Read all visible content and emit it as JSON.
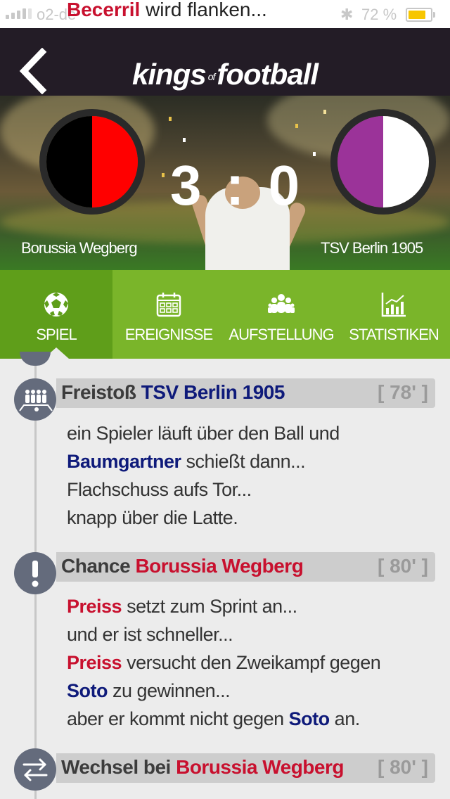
{
  "status_bar": {
    "carrier": "o2-de",
    "banner_player": "Becerril",
    "banner_text": "wird flanken...",
    "battery": "72 %",
    "battery_color": "#f7c600"
  },
  "nav": {
    "back_icon": "chevron-left-icon",
    "logo_kings": "kings",
    "logo_of": "of",
    "logo_football": "football"
  },
  "match": {
    "score_home": "3",
    "score_sep": ":",
    "score_away": "0",
    "home_team": "Borussia Wegberg",
    "away_team": "TSV Berlin 1905",
    "home_colors": [
      "#000000",
      "#ff0000"
    ],
    "away_colors": [
      "#9b3399",
      "#ffffff"
    ]
  },
  "tabs": [
    {
      "label": "SPIEL",
      "icon": "soccer-ball-icon",
      "active": true
    },
    {
      "label": "EREIGNISSE",
      "icon": "calendar-icon",
      "active": false
    },
    {
      "label": "AUFSTELLUNG",
      "icon": "team-icon",
      "active": false
    },
    {
      "label": "STATISTIKEN",
      "icon": "chart-icon",
      "active": false
    }
  ],
  "events": [
    {
      "icon": "wall-freekick-icon",
      "type": "Freistoß",
      "team": "TSV Berlin 1905",
      "minute": "[ 78' ]",
      "lines": [
        [
          "",
          "ein Spieler läuft über den Ball und"
        ],
        [
          "Baumgartner",
          " schießt dann..."
        ],
        [
          "",
          "Flachschuss aufs Tor..."
        ],
        [
          "",
          "knapp über die Latte."
        ]
      ]
    },
    {
      "icon": "exclamation-icon",
      "type": "Chance",
      "team": "Borussia Wegberg",
      "minute": "[ 80' ]",
      "lines": [
        [
          "Preiss",
          " setzt zum Sprint an..."
        ],
        [
          "",
          "und er ist schneller..."
        ],
        [
          "Preiss",
          " versucht den Zweikampf gegen"
        ],
        [
          "Soto",
          " zu gewinnen..."
        ],
        [
          "",
          "aber er kommt nicht gegen ",
          "Soto",
          " an."
        ]
      ]
    },
    {
      "icon": "substitution-icon",
      "type": "Wechsel bei",
      "team": "Borussia Wegberg",
      "minute": "[ 80' ]"
    }
  ],
  "accent_green": "#7ab52a",
  "navy": "#0e1a7a",
  "red": "#c8102e"
}
